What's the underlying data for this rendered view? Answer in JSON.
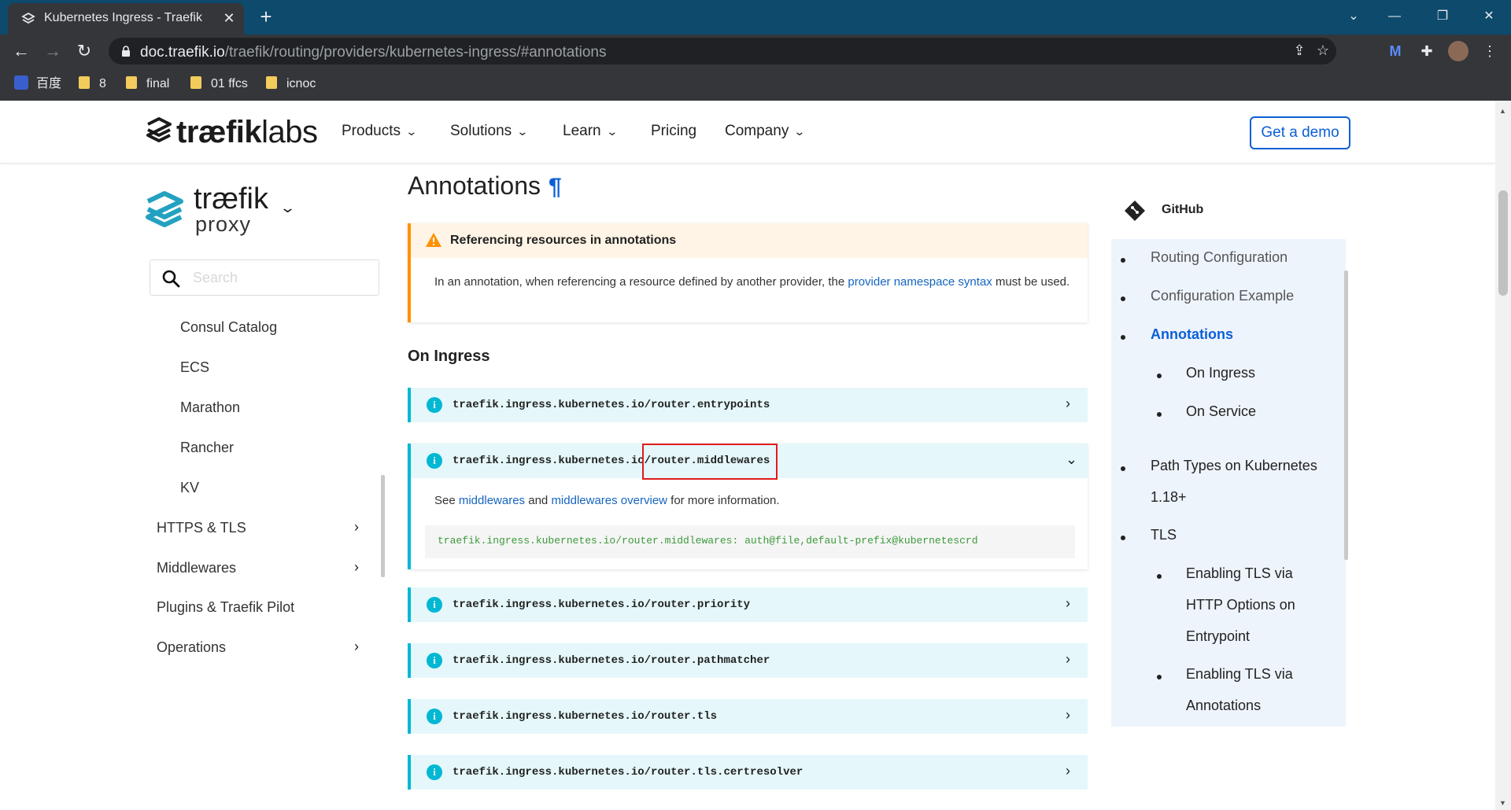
{
  "browser": {
    "tab_title": "Kubernetes Ingress - Traefik",
    "url_host": "doc.traefik.io",
    "url_path": "/traefik/routing/providers/kubernetes-ingress/#annotations",
    "bookmarks": [
      "百度",
      "8",
      "final",
      "01 ffcs",
      "icnoc"
    ]
  },
  "site_header": {
    "logo_text_bold": "træfik",
    "logo_text_light": "labs",
    "nav": [
      "Products",
      "Solutions",
      "Learn",
      "Pricing",
      "Company"
    ],
    "cta": "Get a demo"
  },
  "sidebar": {
    "logo_title": "træfik",
    "logo_subtitle": "proxy",
    "search_placeholder": "Search",
    "items": [
      {
        "label": "Consul Catalog",
        "expandable": false
      },
      {
        "label": "ECS",
        "expandable": false
      },
      {
        "label": "Marathon",
        "expandable": false
      },
      {
        "label": "Rancher",
        "expandable": false
      },
      {
        "label": "KV",
        "expandable": false
      },
      {
        "label": "HTTPS & TLS",
        "expandable": true
      },
      {
        "label": "Middlewares",
        "expandable": true
      },
      {
        "label": "Plugins & Traefik Pilot",
        "expandable": false
      },
      {
        "label": "Operations",
        "expandable": true
      }
    ]
  },
  "main": {
    "heading": "Annotations",
    "heading_anchor": "¶",
    "warning": {
      "title": "Referencing resources in annotations",
      "text_before": "In an annotation, when referencing a resource defined by another provider, the ",
      "link": "provider namespace syntax",
      "text_after": " must be used."
    },
    "subheading": "On Ingress",
    "annotations": [
      {
        "key": "traefik.ingress.kubernetes.io/router.entrypoints",
        "expanded": false
      },
      {
        "key": "traefik.ingress.kubernetes.io/router.middlewares",
        "expanded": true
      },
      {
        "key": "traefik.ingress.kubernetes.io/router.priority",
        "expanded": false
      },
      {
        "key": "traefik.ingress.kubernetes.io/router.pathmatcher",
        "expanded": false
      },
      {
        "key": "traefik.ingress.kubernetes.io/router.tls",
        "expanded": false
      },
      {
        "key": "traefik.ingress.kubernetes.io/router.tls.certresolver",
        "expanded": false
      }
    ],
    "expanded_detail": {
      "see": "See ",
      "link1": "middlewares",
      "and": " and ",
      "link2": "middlewares overview",
      "tail": " for more information.",
      "code": "traefik.ingress.kubernetes.io/router.middlewares: auth@file,default-prefix@kubernetescrd"
    }
  },
  "toc": {
    "github": "GitHub",
    "items": [
      {
        "label": "Routing Configuration",
        "level": 1
      },
      {
        "label": "Configuration Example",
        "level": 1
      },
      {
        "label": "Annotations",
        "level": 1,
        "active": true
      },
      {
        "label": "On Ingress",
        "level": 2
      },
      {
        "label": "On Service",
        "level": 2
      },
      {
        "label": "Path Types on Kubernetes",
        "level": 1
      },
      {
        "label": "1.18+",
        "level": 1
      },
      {
        "label": "TLS",
        "level": 1
      },
      {
        "label": "Enabling TLS via",
        "level": 2
      },
      {
        "label": "HTTP Options on",
        "level": 2
      },
      {
        "label": "Entrypoint",
        "level": 2
      },
      {
        "label": "Enabling TLS via",
        "level": 2
      },
      {
        "label": "Annotations",
        "level": 2
      }
    ]
  },
  "colors": {
    "accent": "#0a5fd8",
    "note_border": "#00b8d4",
    "warning_border": "#ff9100",
    "highlight_box": "#e11b1b"
  }
}
